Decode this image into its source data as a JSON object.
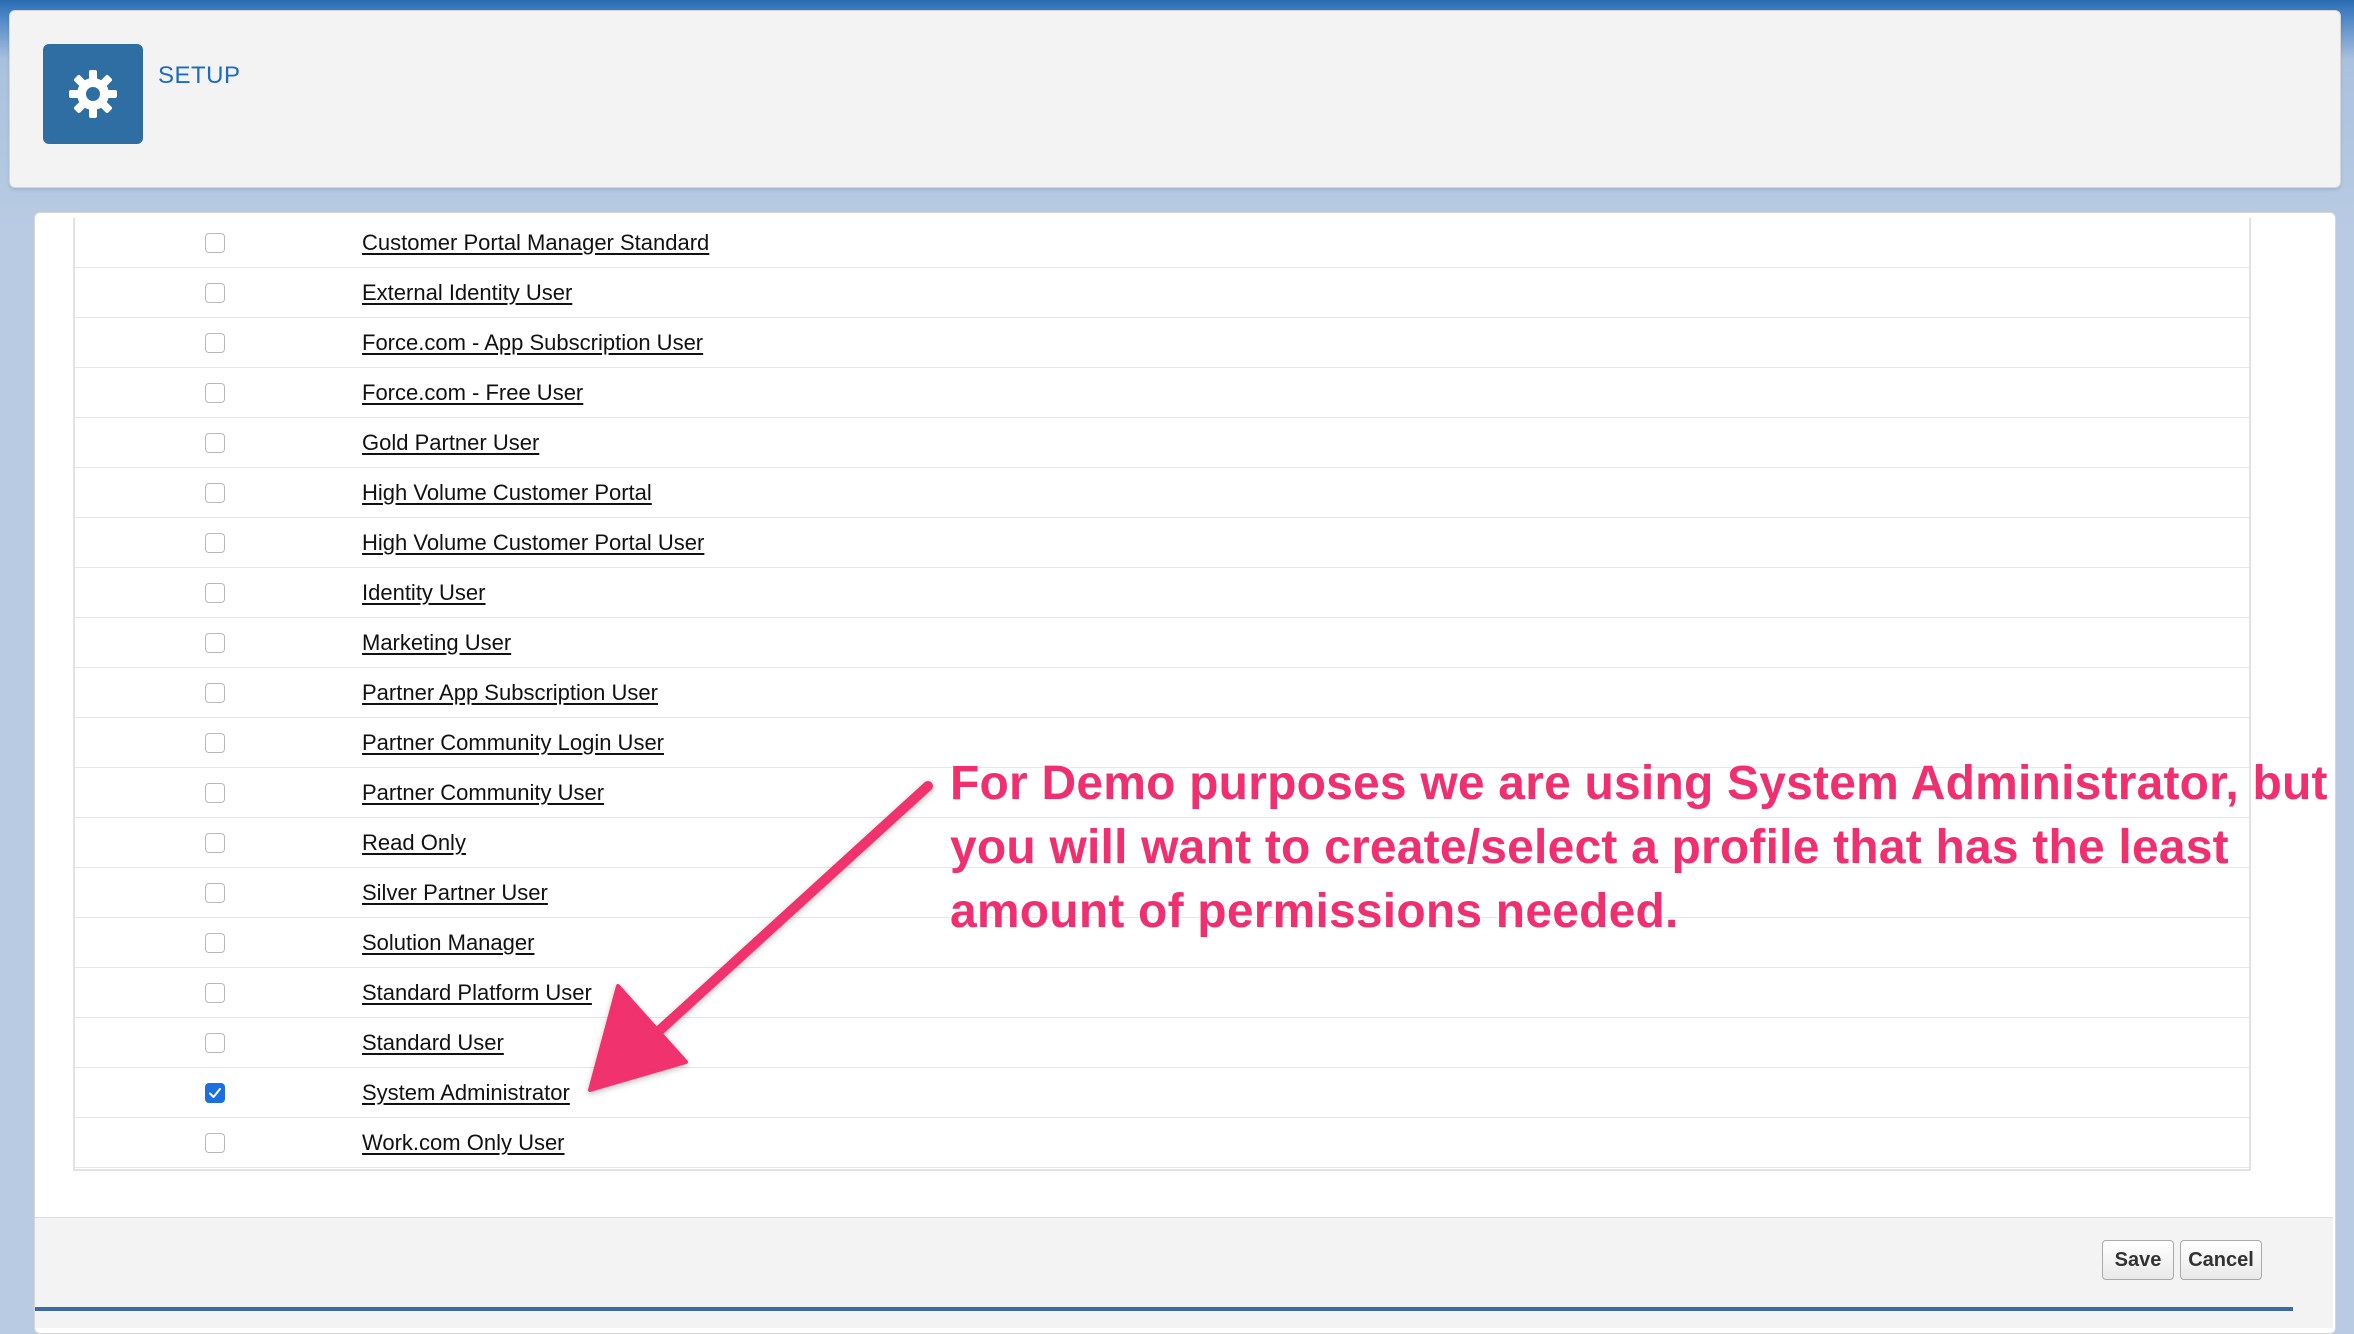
{
  "header": {
    "title": "SETUP",
    "icon": "gear-icon"
  },
  "profiles": [
    {
      "label": "Customer Portal Manager Standard",
      "checked": false
    },
    {
      "label": "External Identity User",
      "checked": false
    },
    {
      "label": "Force.com - App Subscription User",
      "checked": false
    },
    {
      "label": "Force.com - Free User",
      "checked": false
    },
    {
      "label": "Gold Partner User",
      "checked": false
    },
    {
      "label": "High Volume Customer Portal",
      "checked": false
    },
    {
      "label": "High Volume Customer Portal User",
      "checked": false
    },
    {
      "label": "Identity User",
      "checked": false
    },
    {
      "label": "Marketing User",
      "checked": false
    },
    {
      "label": "Partner App Subscription User",
      "checked": false
    },
    {
      "label": "Partner Community Login User",
      "checked": false
    },
    {
      "label": "Partner Community User",
      "checked": false
    },
    {
      "label": "Read Only",
      "checked": false
    },
    {
      "label": "Silver Partner User",
      "checked": false
    },
    {
      "label": "Solution Manager",
      "checked": false
    },
    {
      "label": "Standard Platform User",
      "checked": false
    },
    {
      "label": "Standard User",
      "checked": false
    },
    {
      "label": "System Administrator",
      "checked": true
    },
    {
      "label": "Work.com Only User",
      "checked": false
    }
  ],
  "footer": {
    "save_label": "Save",
    "cancel_label": "Cancel"
  },
  "annotation": {
    "lines": [
      "For Demo purposes we are using System Administrator, but",
      "you will want to create/select a profile that has the least",
      "amount of permissions needed."
    ],
    "color": "#f0306e"
  },
  "colors": {
    "brand_blue": "#2f6ea3",
    "link_blue": "#1b6cc0",
    "checkbox_checked": "#1d6fe0"
  }
}
